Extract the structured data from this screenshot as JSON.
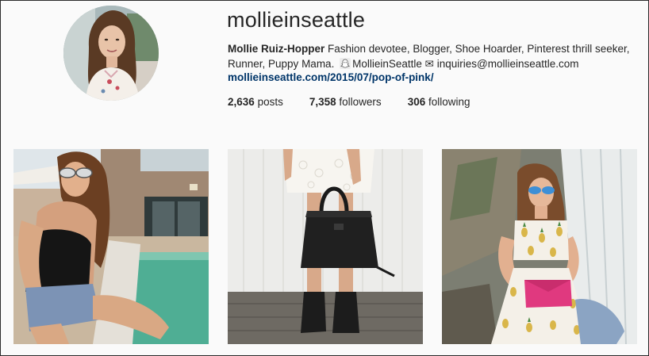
{
  "profile": {
    "username": "mollieinseattle",
    "full_name": "Mollie Ruiz-Hopper",
    "bio_text": "Fashion devotee, Blogger, Shoe Hoarder, Pinterest thrill seeker, Runner, Puppy Mama.",
    "snapchat_handle": "MollieinSeattle",
    "email_icon_glyph": "✉",
    "email": "inquiries@mollieinseattle.com",
    "website": "mollieinseattle.com/2015/07/pop-of-pink/",
    "link_color": "#003569"
  },
  "stats": {
    "posts_count": "2,636",
    "posts_label": "posts",
    "followers_count": "7,358",
    "followers_label": "followers",
    "following_count": "306",
    "following_label": "following"
  },
  "icons": {
    "bio_icon": "snapchat-ghost-icon",
    "email_icon": "envelope-icon"
  },
  "grid": {
    "photos": [
      {
        "subject": "woman-sunglasses-pool-photo"
      },
      {
        "subject": "black-tote-bag-boots-photo"
      },
      {
        "subject": "pineapple-dress-waterfall-photo"
      }
    ]
  }
}
